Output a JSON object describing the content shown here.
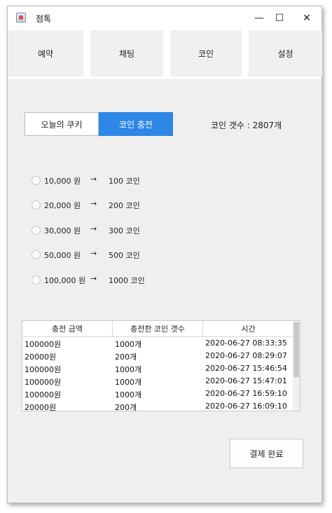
{
  "window": {
    "title": "점톡"
  },
  "tabs": [
    {
      "label": "예약"
    },
    {
      "label": "채팅"
    },
    {
      "label": "코인"
    },
    {
      "label": "설정"
    }
  ],
  "segment": {
    "left_label": "오늘의 쿠키",
    "right_label": "코인 충전",
    "selected": "코인 충전"
  },
  "coin_count": "코인 갯수 : 2807개",
  "options": [
    {
      "won": "10,000 원",
      "arrow": "→",
      "coins": "100 코인"
    },
    {
      "won": "20,000 원",
      "arrow": "→",
      "coins": "200 코인"
    },
    {
      "won": "30,000 원",
      "arrow": "→",
      "coins": "300 코인"
    },
    {
      "won": "50,000 원",
      "arrow": "→",
      "coins": "500 코인"
    },
    {
      "won": "100,000 원",
      "arrow": "→",
      "coins": "1000 코인"
    }
  ],
  "history": {
    "headers": [
      "충전 금액",
      "충전한 코인 갯수",
      "시간"
    ],
    "rows": [
      [
        "100000원",
        "1000개",
        "2020-06-27 08:33:35"
      ],
      [
        "20000원",
        "200개",
        "2020-06-27 08:29:07"
      ],
      [
        "100000원",
        "1000개",
        "2020-06-27 15:46:54"
      ],
      [
        "100000원",
        "1000개",
        "2020-06-27 15:47:01"
      ],
      [
        "100000원",
        "1000개",
        "2020-06-27 16:59:10"
      ],
      [
        "20000원",
        "200개",
        "2020-06-27 16:09:10"
      ]
    ]
  },
  "pay_button": {
    "label": "결제 완료"
  },
  "icons": {
    "app": "java-app-icon",
    "minimize": "minimize-icon",
    "maximize": "maximize-icon",
    "close": "close-icon"
  },
  "colors": {
    "accent": "#2e87e6"
  }
}
